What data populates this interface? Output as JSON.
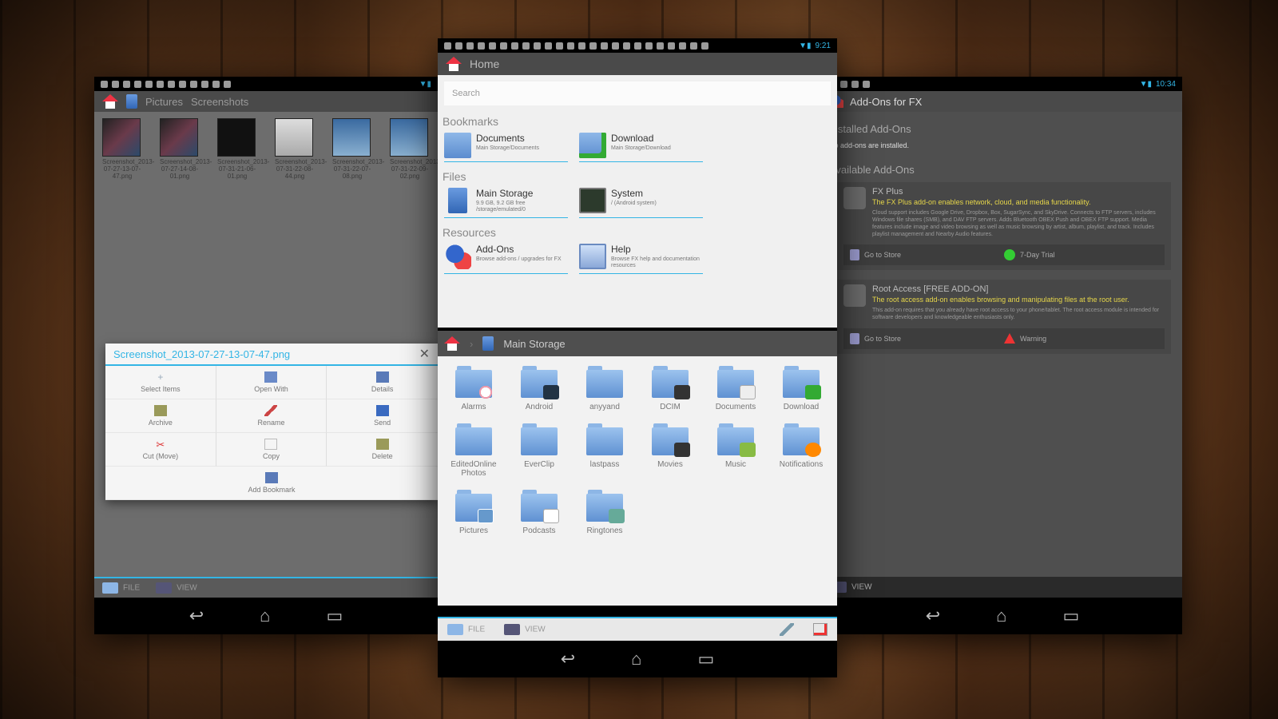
{
  "left": {
    "breadcrumb": [
      "Pictures",
      "Screenshots"
    ],
    "thumbnails": [
      {
        "name": "Screenshot_2013-07-27-13-07-47.png"
      },
      {
        "name": "Screenshot_2013-07-27-14-08-01.png"
      },
      {
        "name": "Screenshot_2013-07-31-21-06-01.png"
      },
      {
        "name": "Screenshot_2013-07-31-22-08-44.png"
      },
      {
        "name": "Screenshot_2013-07-31-22-07-08.png"
      },
      {
        "name": "Screenshot_2013-07-31-22-09-02.png"
      }
    ],
    "dialog": {
      "title": "Screenshot_2013-07-27-13-07-47.png",
      "close": "✕",
      "actions": [
        "Select Items",
        "Open With",
        "Details",
        "Archive",
        "Rename",
        "Send",
        "Cut (Move)",
        "Copy",
        "Delete",
        "Add Bookmark"
      ]
    },
    "bottombar": {
      "file": "FILE",
      "view": "VIEW"
    }
  },
  "center": {
    "title": "Home",
    "search_placeholder": "Search",
    "sections": {
      "bookmarks": "Bookmarks",
      "files": "Files",
      "resources": "Resources"
    },
    "bookmarks": [
      {
        "title": "Documents",
        "sub": "Main Storage/Documents"
      },
      {
        "title": "Download",
        "sub": "Main Storage/Download"
      }
    ],
    "files": [
      {
        "title": "Main Storage",
        "sub": "9.9 GB, 9.2 GB free /storage/emulated/0"
      },
      {
        "title": "System",
        "sub": "/ (Android system)"
      }
    ],
    "resources": [
      {
        "title": "Add-Ons",
        "sub": "Browse add-ons / upgrades for FX"
      },
      {
        "title": "Help",
        "sub": "Browse FX help and documentation resources"
      }
    ],
    "pane2_title": "Main Storage",
    "folders": [
      "Alarms",
      "Android",
      "anyyand",
      "DCIM",
      "Documents",
      "Download",
      "EditedOnline Photos",
      "EverClip",
      "lastpass",
      "Movies",
      "Music",
      "Notifications",
      "Pictures",
      "Podcasts",
      "Ringtones"
    ],
    "bottombar": {
      "file": "FILE",
      "view": "VIEW"
    }
  },
  "right": {
    "title": "Add-Ons for FX",
    "time": "10:34",
    "installed_header": "Installed Add-Ons",
    "installed_note": "No add-ons are installed.",
    "available_header": "Available Add-Ons",
    "addons": [
      {
        "name": "FX Plus",
        "desc": "The FX Plus add-on enables network, cloud, and media functionality.",
        "detail": "Cloud support includes Google Drive, Dropbox, Box, SugarSync, and SkyDrive. Connects to FTP servers, includes Windows file shares (SMB), and DAV FTP servers. Adds Bluetooth OBEX Push and OBEX FTP support. Media features include image and video browsing as well as music browsing by artist, album, playlist, and track. Includes playlist management and Nearby Audio features.",
        "action1": "Go to Store",
        "action2": "7-Day Trial"
      },
      {
        "name": "Root Access [FREE ADD-ON]",
        "desc": "The root access add-on enables browsing and manipulating files at the root user.",
        "detail": "This add-on requires that you already have root access to your phone/tablet. The root access module is intended for software developers and knowledgeable enthusiasts only.",
        "action1": "Go to Store",
        "action2": "Warning"
      }
    ],
    "bottombar": {
      "view": "VIEW"
    }
  },
  "status_time_center": "9:21"
}
